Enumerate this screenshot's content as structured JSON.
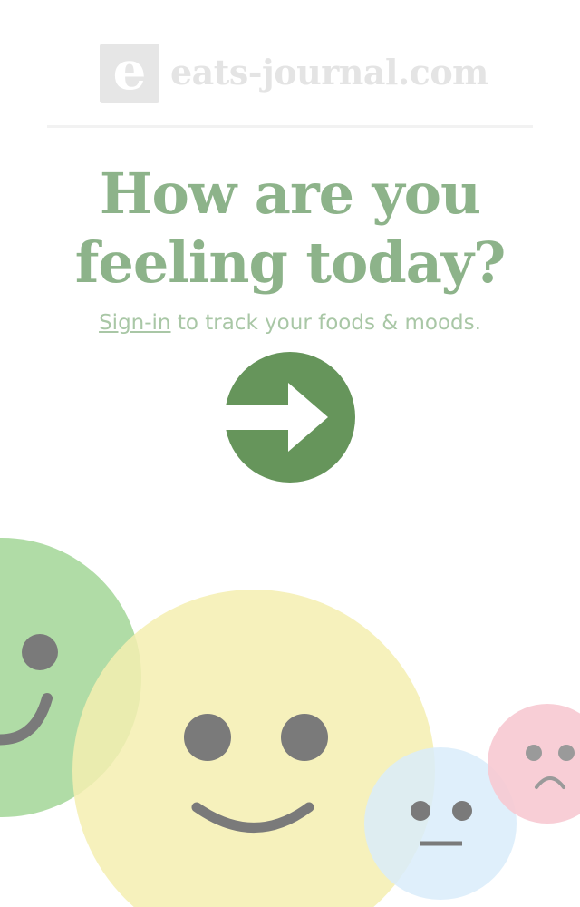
{
  "logo": {
    "letter": "e",
    "name": "eats-journal.com"
  },
  "headline": {
    "line1": "How are you",
    "line2": "feeling today?"
  },
  "prompt": {
    "link_label": "Sign-in",
    "text": " to track your foods & moods."
  },
  "go_button": {
    "icon": "arrow-right-icon"
  },
  "colors": {
    "accent": "#66955b",
    "headline": "#8db38a",
    "face_happy": "#a7d89c",
    "face_content": "#f5efb0",
    "face_neutral": "#d9ecfa",
    "face_sad": "#f7c9d2",
    "face_features": "#7a7a7a"
  },
  "mood_faces": [
    "happy-face-icon",
    "smiling-face-icon",
    "neutral-face-icon",
    "sad-face-icon"
  ]
}
